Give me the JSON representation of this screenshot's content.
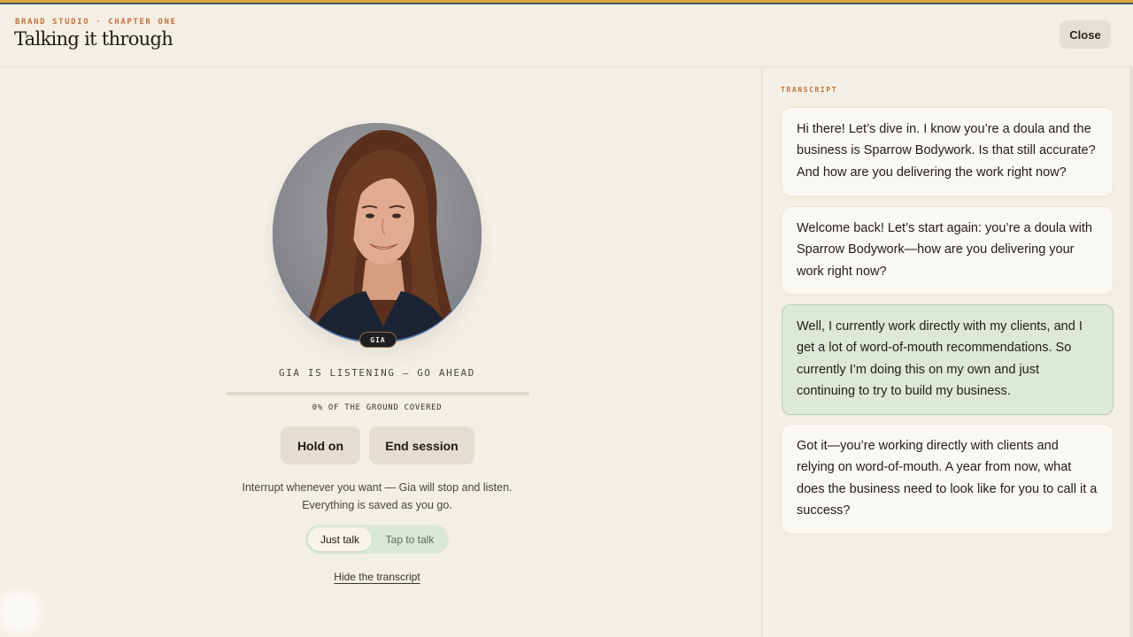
{
  "header": {
    "eyebrow": "BRAND STUDIO · CHAPTER ONE",
    "title": "Talking it through",
    "close_label": "Close"
  },
  "stage": {
    "speaker_tag": "GIA",
    "status": "GIA IS LISTENING — GO AHEAD",
    "progress_percent": 0,
    "progress_label": "0% OF THE GROUND COVERED",
    "hold_label": "Hold on",
    "end_label": "End session",
    "hint_line1": "Interrupt whenever you want — Gia will stop and listen.",
    "hint_line2": "Everything is saved as you go.",
    "mode_options": [
      "Just talk",
      "Tap to talk"
    ],
    "mode_selected": "Just talk",
    "hide_transcript_label": "Hide the transcript"
  },
  "transcript": {
    "label": "TRANSCRIPT",
    "messages": [
      {
        "speaker": "assistant",
        "text": "Hi there! Let’s dive in. I know you’re a doula and the business is Sparrow Bodywork. Is that still accurate? And how are you delivering the work right now?"
      },
      {
        "speaker": "assistant",
        "text": "Welcome back! Let’s start again: you’re a doula with Sparrow Bodywork—how are you delivering your work right now?"
      },
      {
        "speaker": "user",
        "text": "Well, I currently work directly with my clients, and I get a lot of word-of-mouth recommendations. So currently I’m doing this on my own and just continuing to try to build my business."
      },
      {
        "speaker": "assistant",
        "text": "Got it—you’re working directly with clients and relying on word-of-mouth. A year from now, what does the business need to look like for you to call it a success?"
      }
    ]
  },
  "colors": {
    "accent": "#c4703a",
    "user_bubble": "#dde9d6",
    "toggle_bg": "#dbe8d8"
  }
}
